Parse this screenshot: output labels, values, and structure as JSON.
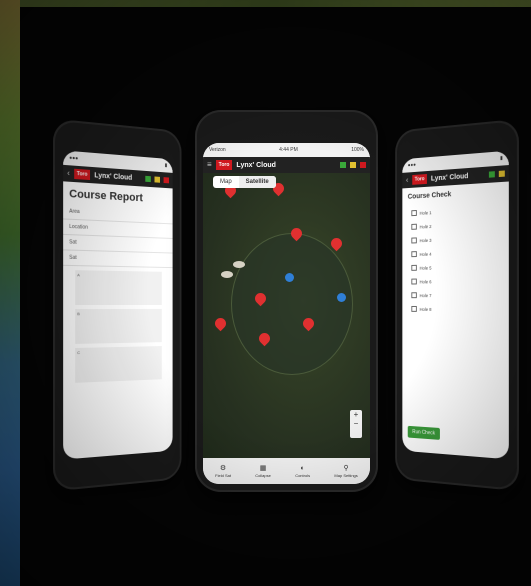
{
  "app": {
    "title": "Lynx' Cloud",
    "logo": "Toro"
  },
  "center": {
    "status": {
      "left": "Verizon",
      "time": "4:44 PM",
      "right": "100%"
    },
    "tabs": [
      "Map",
      "Satellite"
    ],
    "nav": [
      {
        "label": "Field Sat",
        "icon": "gear-icon"
      },
      {
        "label": "Collapse",
        "icon": "grid-icon"
      },
      {
        "label": "Controls",
        "icon": "controls-icon"
      },
      {
        "label": "Map Settings",
        "icon": "pin-icon"
      }
    ],
    "zoom": [
      "+",
      "−"
    ]
  },
  "left": {
    "title": "Course Report",
    "rows": [
      "Area",
      "Location",
      "Sat",
      "Sat"
    ],
    "cards": [
      "A",
      "B",
      "C"
    ]
  },
  "right": {
    "title": "Course Check",
    "items": [
      "Hole 1",
      "Hole 2",
      "Hole 3",
      "Hole 4",
      "Hole 5",
      "Hole 6",
      "Hole 7",
      "Hole 8"
    ],
    "button": "Run Check"
  },
  "colors": {
    "brand": "#d0191f",
    "pin": "#e03030",
    "blue_pin": "#2f7fd6",
    "green": "#3a9a3a"
  }
}
